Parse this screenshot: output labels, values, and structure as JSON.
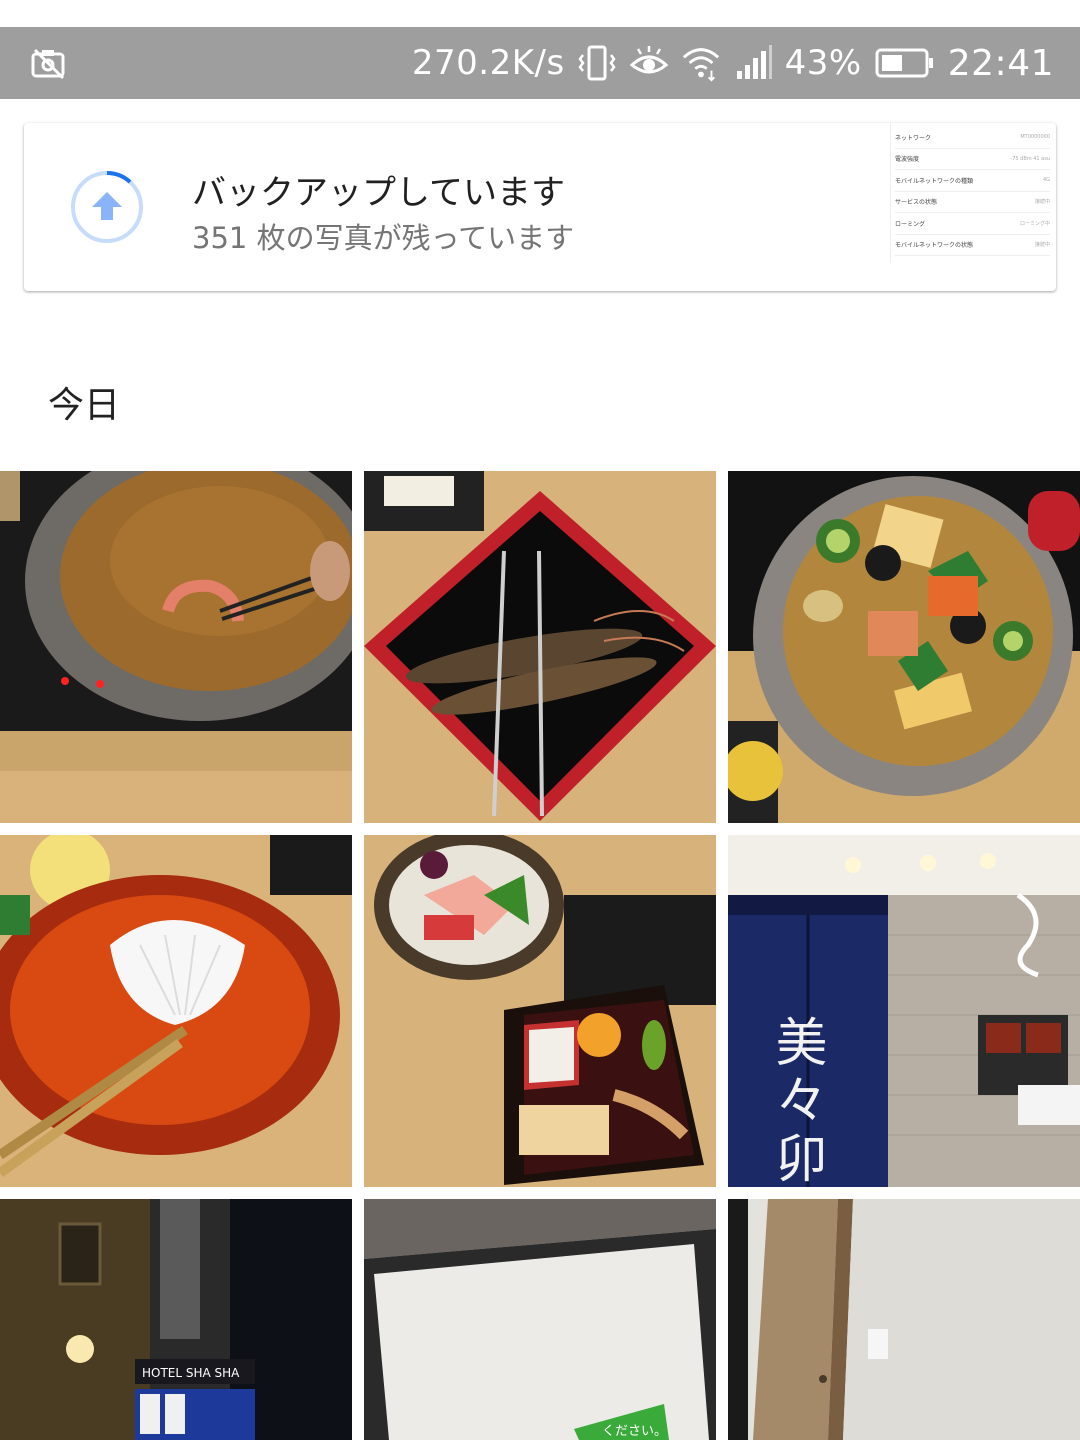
{
  "status_bar": {
    "speed": "270.2K/s",
    "battery_percent": "43%",
    "time": "22:41",
    "icons": [
      "camera-off-icon",
      "vibrate-icon",
      "eye-comfort-icon",
      "wifi-icon",
      "signal-icon",
      "battery-icon"
    ]
  },
  "backup_card": {
    "title": "バックアップしています",
    "subtitle": "351 枚の写真が残っています",
    "thumbnail_rows": [
      {
        "label": "ネットワーク",
        "value": "MT0000000"
      },
      {
        "label": "電波強度",
        "value": "-75 dBm 41 asu"
      },
      {
        "label": "モバイルネットワークの種類",
        "value": "4G"
      },
      {
        "label": "サービスの状態",
        "value": "接続中"
      },
      {
        "label": "ローミング",
        "value": "ローミング中"
      },
      {
        "label": "モバイルネットワークの状態",
        "value": "接続中"
      }
    ]
  },
  "section": {
    "header": "今日"
  },
  "photos": [
    {
      "subject": "shrimp-hotpot-broth"
    },
    {
      "subject": "raw-prawns-on-tray"
    },
    {
      "subject": "vegetable-hotpot"
    },
    {
      "subject": "red-bowl-with-shell"
    },
    {
      "subject": "sashimi-and-bento"
    },
    {
      "subject": "restaurant-entrance",
      "sign_text": "美々卯"
    },
    {
      "subject": "hotel-at-night",
      "sign_text": "HOTEL SHA SHA"
    },
    {
      "subject": "screen-notice",
      "sign_text": "ください。"
    },
    {
      "subject": "room-door-wall"
    }
  ]
}
